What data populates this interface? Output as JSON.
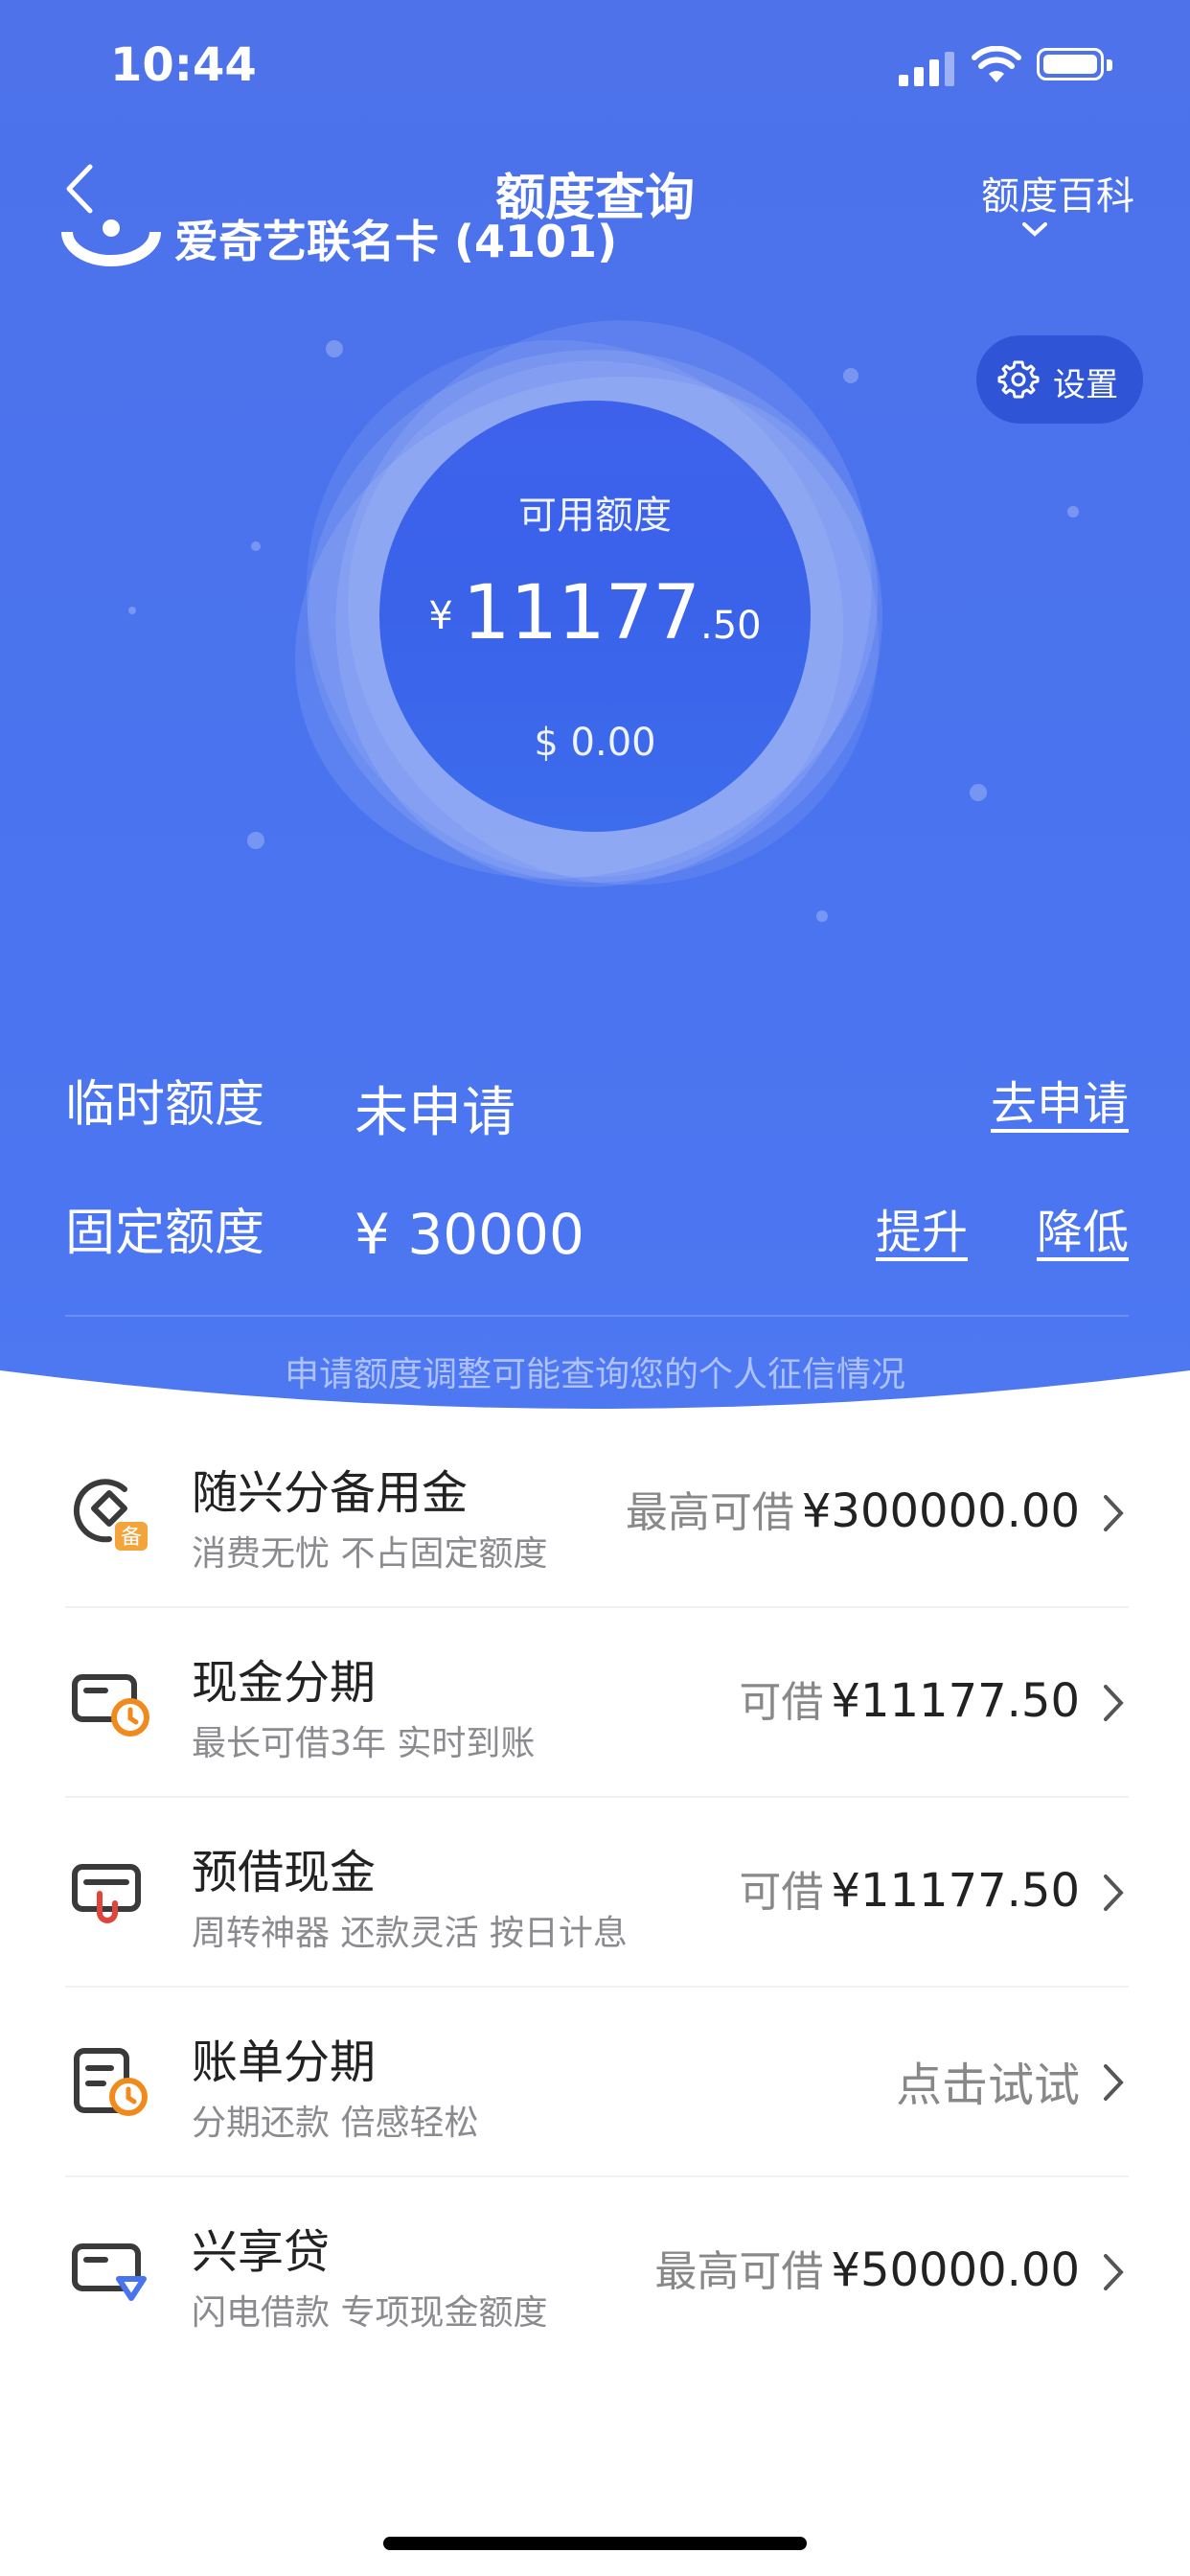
{
  "status": {
    "time": "10:44"
  },
  "nav": {
    "title": "额度查询",
    "right": "额度百科"
  },
  "card": {
    "name": "爱奇艺联名卡 (4101)"
  },
  "settings": {
    "label": "设置"
  },
  "available": {
    "label": "可用额度",
    "currency": "¥",
    "integer": "11177",
    "decimal": ".50",
    "usd": "$ 0.00"
  },
  "temp_limit": {
    "label": "临时额度",
    "value": "未申请",
    "action": "去申请"
  },
  "fixed_limit": {
    "label": "固定额度",
    "value": "¥ 30000",
    "raise": "提升",
    "lower": "降低"
  },
  "notice": "申请额度调整可能查询您的个人征信情况",
  "items": [
    {
      "title": "随兴分备用金",
      "subtitle": "消费无忧 不占固定额度",
      "prefix": "最高可借",
      "amount": "¥300000.00",
      "icon": "reserve-fund-icon"
    },
    {
      "title": "现金分期",
      "subtitle": "最长可借3年 实时到账",
      "prefix": "可借",
      "amount": "¥11177.50",
      "icon": "cash-installment-icon"
    },
    {
      "title": "预借现金",
      "subtitle": "周转神器 还款灵活 按日计息",
      "prefix": "可借",
      "amount": "¥11177.50",
      "icon": "cash-advance-icon"
    },
    {
      "title": "账单分期",
      "subtitle": "分期还款 倍感轻松",
      "prefix": "",
      "amount": "点击试试",
      "icon": "bill-installment-icon"
    },
    {
      "title": "兴享贷",
      "subtitle": "闪电借款 专项现金额度",
      "prefix": "最高可借",
      "amount": "¥50000.00",
      "icon": "xingxiang-loan-icon"
    }
  ],
  "colors": {
    "primary_blue": "#4a73ef",
    "circle_blue": "#3e61ec",
    "accent_orange": "#f08a1c",
    "accent_red": "#e0443a"
  }
}
